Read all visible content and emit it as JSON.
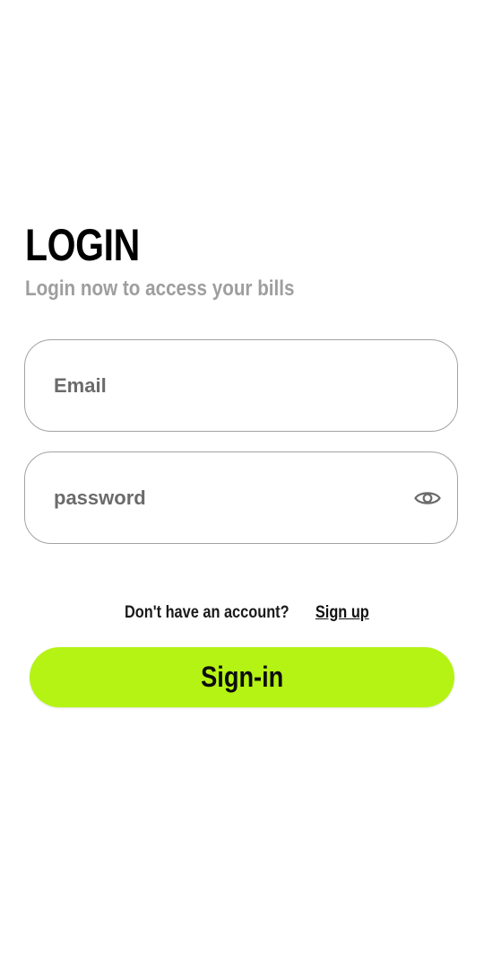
{
  "header": {
    "title": "LOGIN",
    "subtitle": "Login now to access your bills"
  },
  "form": {
    "email_placeholder": "Email",
    "password_placeholder": "password",
    "password_toggle_icon": "eye-icon"
  },
  "footer": {
    "question": "Don't have an account?",
    "signup_link": "Sign up"
  },
  "actions": {
    "signin_label": "Sign-in"
  },
  "colors": {
    "accent": "#b5f314",
    "subtitle": "#9e9e9e",
    "border": "#a3a3a3"
  }
}
